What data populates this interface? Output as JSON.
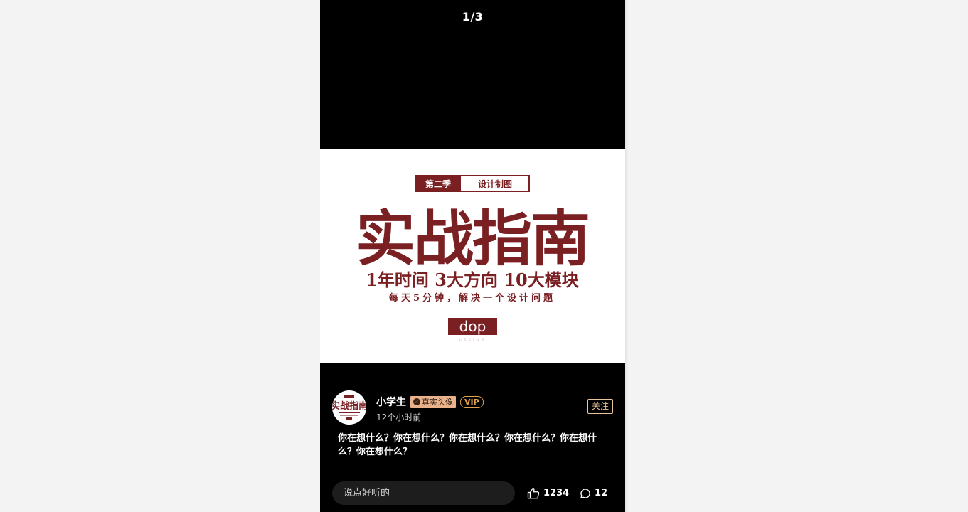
{
  "viewer": {
    "counter": "1/3"
  },
  "poster": {
    "season_tag": "第二季",
    "subtitle_tag": "设计制图",
    "headline": "实战指南",
    "tagline": "1年时间  3大方向  10大模块",
    "slogan": "每天5分钟，解决一个设计问题",
    "logo_text": "dop",
    "logo_sub": "DESIGN",
    "brand_color": "#7a1f22"
  },
  "author": {
    "username": "小学生",
    "real_avatar_badge": "真实头像",
    "vip_badge": "VIP",
    "timestamp": "12个小时前",
    "follow_label": "关注"
  },
  "post": {
    "text": "你在想什么？你在想什么？你在想什么？你在想什么？你在想什么？你在想什么？"
  },
  "actions": {
    "comment_placeholder": "说点好听的",
    "like_count": "1234",
    "comment_count": "12"
  }
}
